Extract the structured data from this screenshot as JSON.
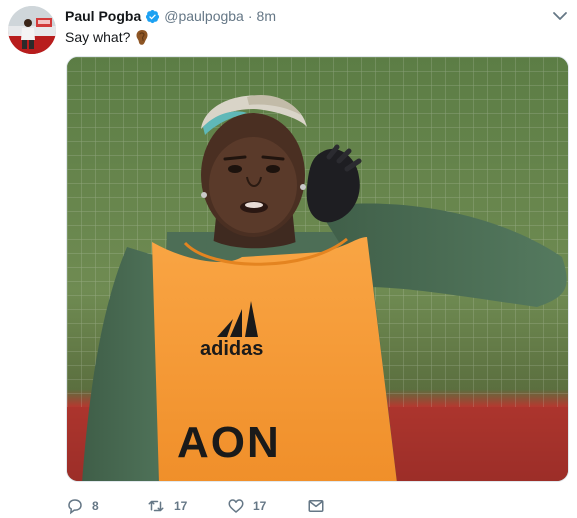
{
  "tweet": {
    "name": "Paul Pogba",
    "handle": "@paulpogba",
    "separator": "·",
    "time": "8m",
    "text": "Say what?",
    "emoji": "ear-emoji",
    "verified_icon": "verified-badge-icon",
    "caret_icon": "chevron-down-icon",
    "accent_color": "#1da1f2",
    "actions": {
      "reply": {
        "icon": "reply-icon",
        "count": "8"
      },
      "retweet": {
        "icon": "retweet-icon",
        "count": "17"
      },
      "like": {
        "icon": "heart-icon",
        "count": "17"
      },
      "message": {
        "icon": "envelope-icon"
      }
    }
  },
  "media": {
    "jersey_brand": "adidas",
    "jersey_sponsor": "AON",
    "bib_color": "#f7a13a"
  }
}
